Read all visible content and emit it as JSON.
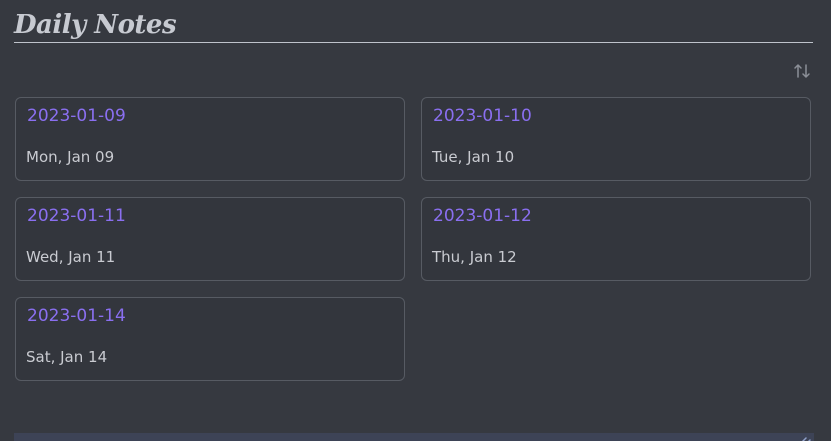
{
  "header": {
    "title": "Daily Notes"
  },
  "toolbar": {
    "sort_icon": "sort-arrows-icon"
  },
  "notes": [
    {
      "title": "2023-01-09",
      "subtitle": "Mon, Jan 09"
    },
    {
      "title": "2023-01-10",
      "subtitle": "Tue, Jan 10"
    },
    {
      "title": "2023-01-11",
      "subtitle": "Wed, Jan 11"
    },
    {
      "title": "2023-01-12",
      "subtitle": "Thu, Jan 12"
    },
    {
      "title": "2023-01-14",
      "subtitle": "Sat, Jan 14"
    }
  ],
  "colors": {
    "background": "#363940",
    "accent": "#8a6ff0",
    "card_border": "#575b63",
    "text": "#c9cbd1"
  }
}
